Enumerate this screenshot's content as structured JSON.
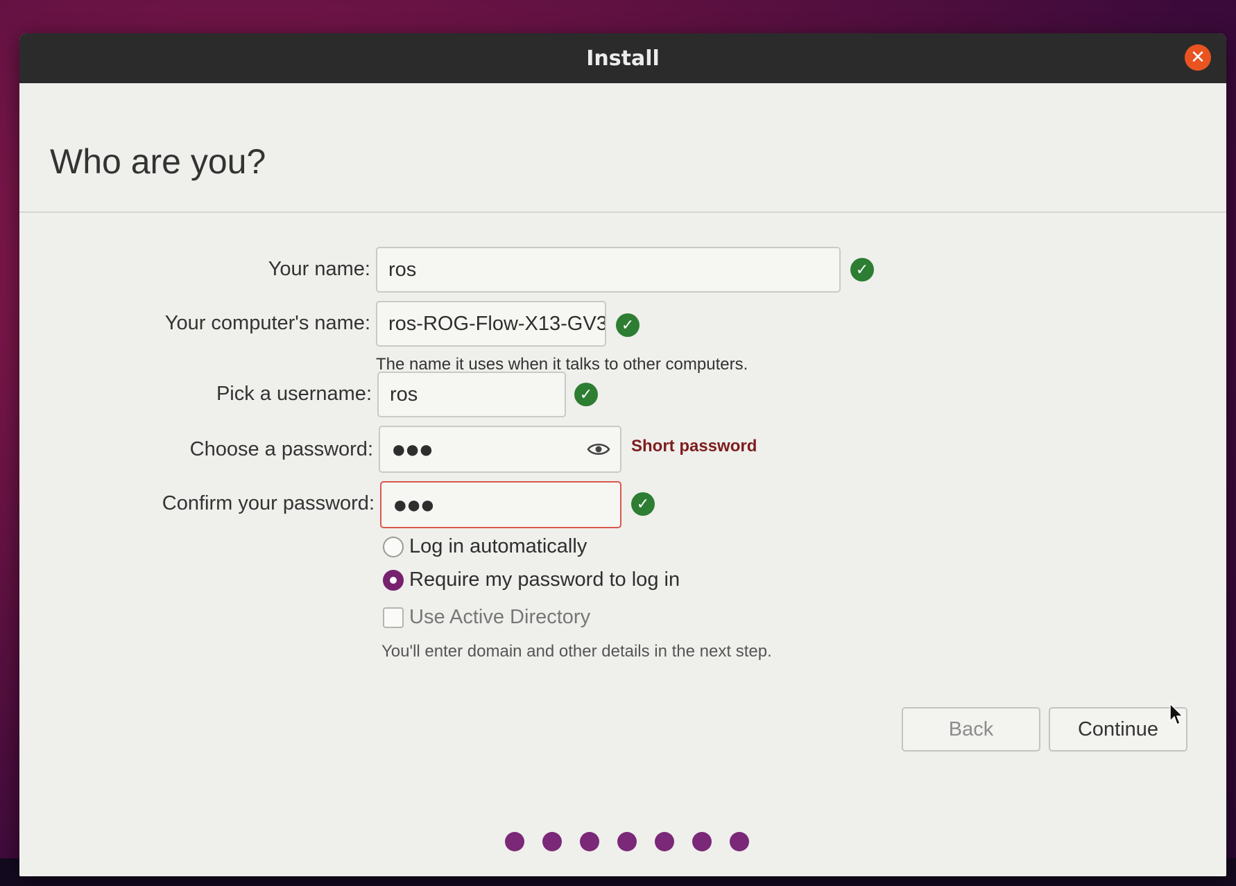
{
  "window": {
    "title": "Install",
    "close_label": "✕"
  },
  "page": {
    "title": "Who are you?"
  },
  "form": {
    "your_name": {
      "label": "Your name:",
      "value": "ros"
    },
    "computer_name": {
      "label": "Your computer's name:",
      "value": "ros-ROG-Flow-X13-GV3",
      "hint": "The name it uses when it talks to other computers."
    },
    "username": {
      "label": "Pick a username:",
      "value": "ros"
    },
    "password": {
      "label": "Choose a password:",
      "value": "●●●",
      "warning": "Short password"
    },
    "confirm_password": {
      "label": "Confirm your password:",
      "value": "●●●"
    },
    "check_mark": "✓"
  },
  "login_options": {
    "auto_login": {
      "label": "Log in automatically",
      "selected": false
    },
    "require_password": {
      "label": "Require my password to log in",
      "selected": true
    }
  },
  "active_directory": {
    "label": "Use Active Directory",
    "checked": false,
    "hint": "You'll enter domain and other details in the next step."
  },
  "buttons": {
    "back": "Back",
    "continue": "Continue"
  },
  "progress": {
    "total_steps": 7
  },
  "colors": {
    "accent": "#77216f",
    "success": "#2d7d32",
    "warning_text": "#7d1d1d",
    "close": "#e95420",
    "titlebar": "#2b2b2b"
  }
}
